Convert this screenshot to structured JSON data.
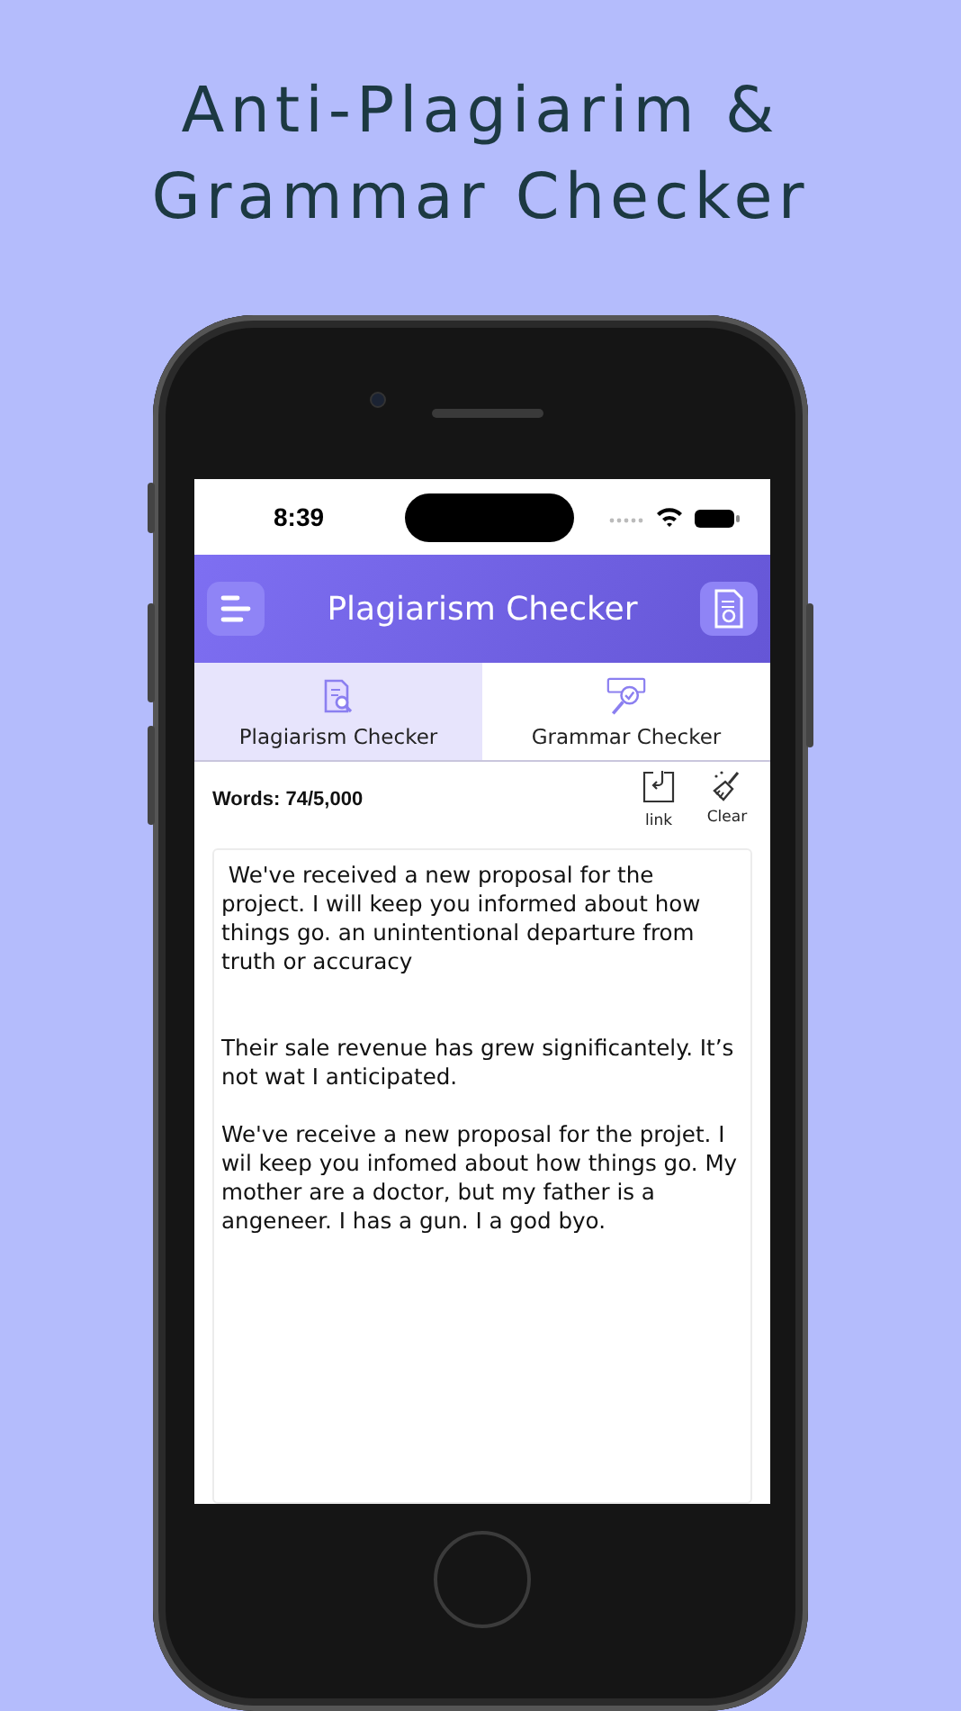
{
  "headline": [
    "Anti-Plagiarim &",
    "Grammar Checker"
  ],
  "status_bar": {
    "time": "8:39"
  },
  "header": {
    "title": "Plagiarism Checker"
  },
  "tabs": [
    {
      "label": "Plagiarism Checker",
      "kind": "plagiarism",
      "selected": true
    },
    {
      "label": "Grammar Checker",
      "kind": "grammar",
      "selected": false
    }
  ],
  "toolbar": {
    "word_count": "Words: 74/5,000",
    "actions": [
      {
        "label": "link",
        "kind": "import"
      },
      {
        "label": "Clear",
        "kind": "clear"
      }
    ]
  },
  "editor": {
    "paragraphs": [
      " We've received a new proposal for the project. I will keep you informed about how things go. an unintentional departure from truth or accuracy",
      "Their sale revenue has grew significantely. It’s not wat I anticipated.",
      "We've receive a new proposal for the projet. I wil keep you infomed about how things go. My mother are a doctor, but my father is a angeneer. I has a gun. I a god byo."
    ]
  }
}
